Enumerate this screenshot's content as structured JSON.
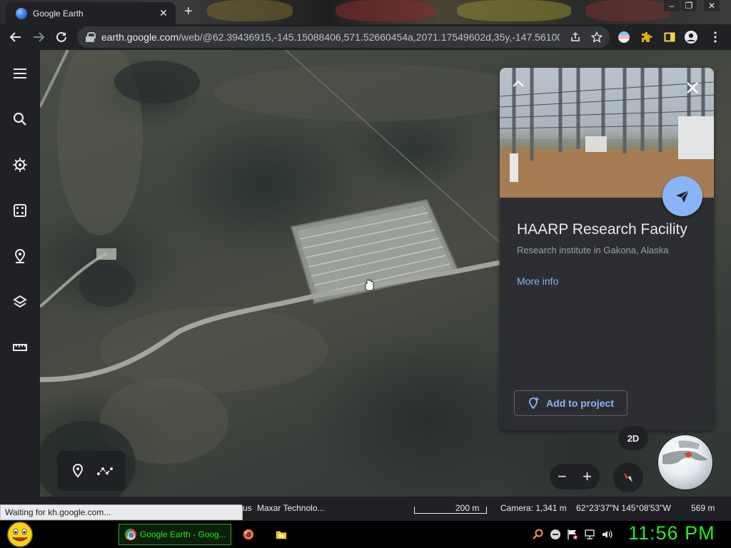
{
  "browser": {
    "tab_title": "Google Earth",
    "tab_close": "✕",
    "new_tab": "+",
    "window_controls": [
      "–",
      "❐",
      "✕"
    ],
    "url_host": "earth.google.com",
    "url_path": "/web/@62.39436915,-145.15088406,571.52660454a,2071.17549602d,35y,-147.56100...",
    "icons": [
      "back-icon",
      "forward-icon",
      "reload-icon",
      "lock-icon",
      "share-icon",
      "star-icon",
      "extension-icon",
      "puzzle-icon",
      "sidepanel-icon",
      "profile-icon",
      "menu-icon"
    ]
  },
  "rail": {
    "items": [
      "menu-icon",
      "search-icon",
      "voyager-icon",
      "dice-icon",
      "pin-icon",
      "layers-icon",
      "ruler-icon"
    ]
  },
  "card": {
    "title": "HAARP Research Facility",
    "subtitle": "Research institute in Gakona, Alaska",
    "more_info": "More info",
    "add_to_project": "Add to project"
  },
  "controls": {
    "mode_2d": "2D",
    "zoom_out": "−",
    "zoom_in": "+"
  },
  "status": {
    "loading": "Waiting for kh.google.com...",
    "attribution_tail": "us",
    "attribution": "Maxar Technolo...",
    "scale": "200 m",
    "camera": "Camera: 1,341 m",
    "coords": "62°23'37\"N 145°08'53\"W",
    "elevation": "569 m"
  },
  "taskbar": {
    "app_label": "Google Earth - Goog...",
    "clock": "11:56 PM"
  },
  "colors": {
    "accent": "#8ab4f8",
    "panel": "#2d2e31",
    "chrome_dark": "#202124",
    "clock_green": "#22ee22"
  }
}
